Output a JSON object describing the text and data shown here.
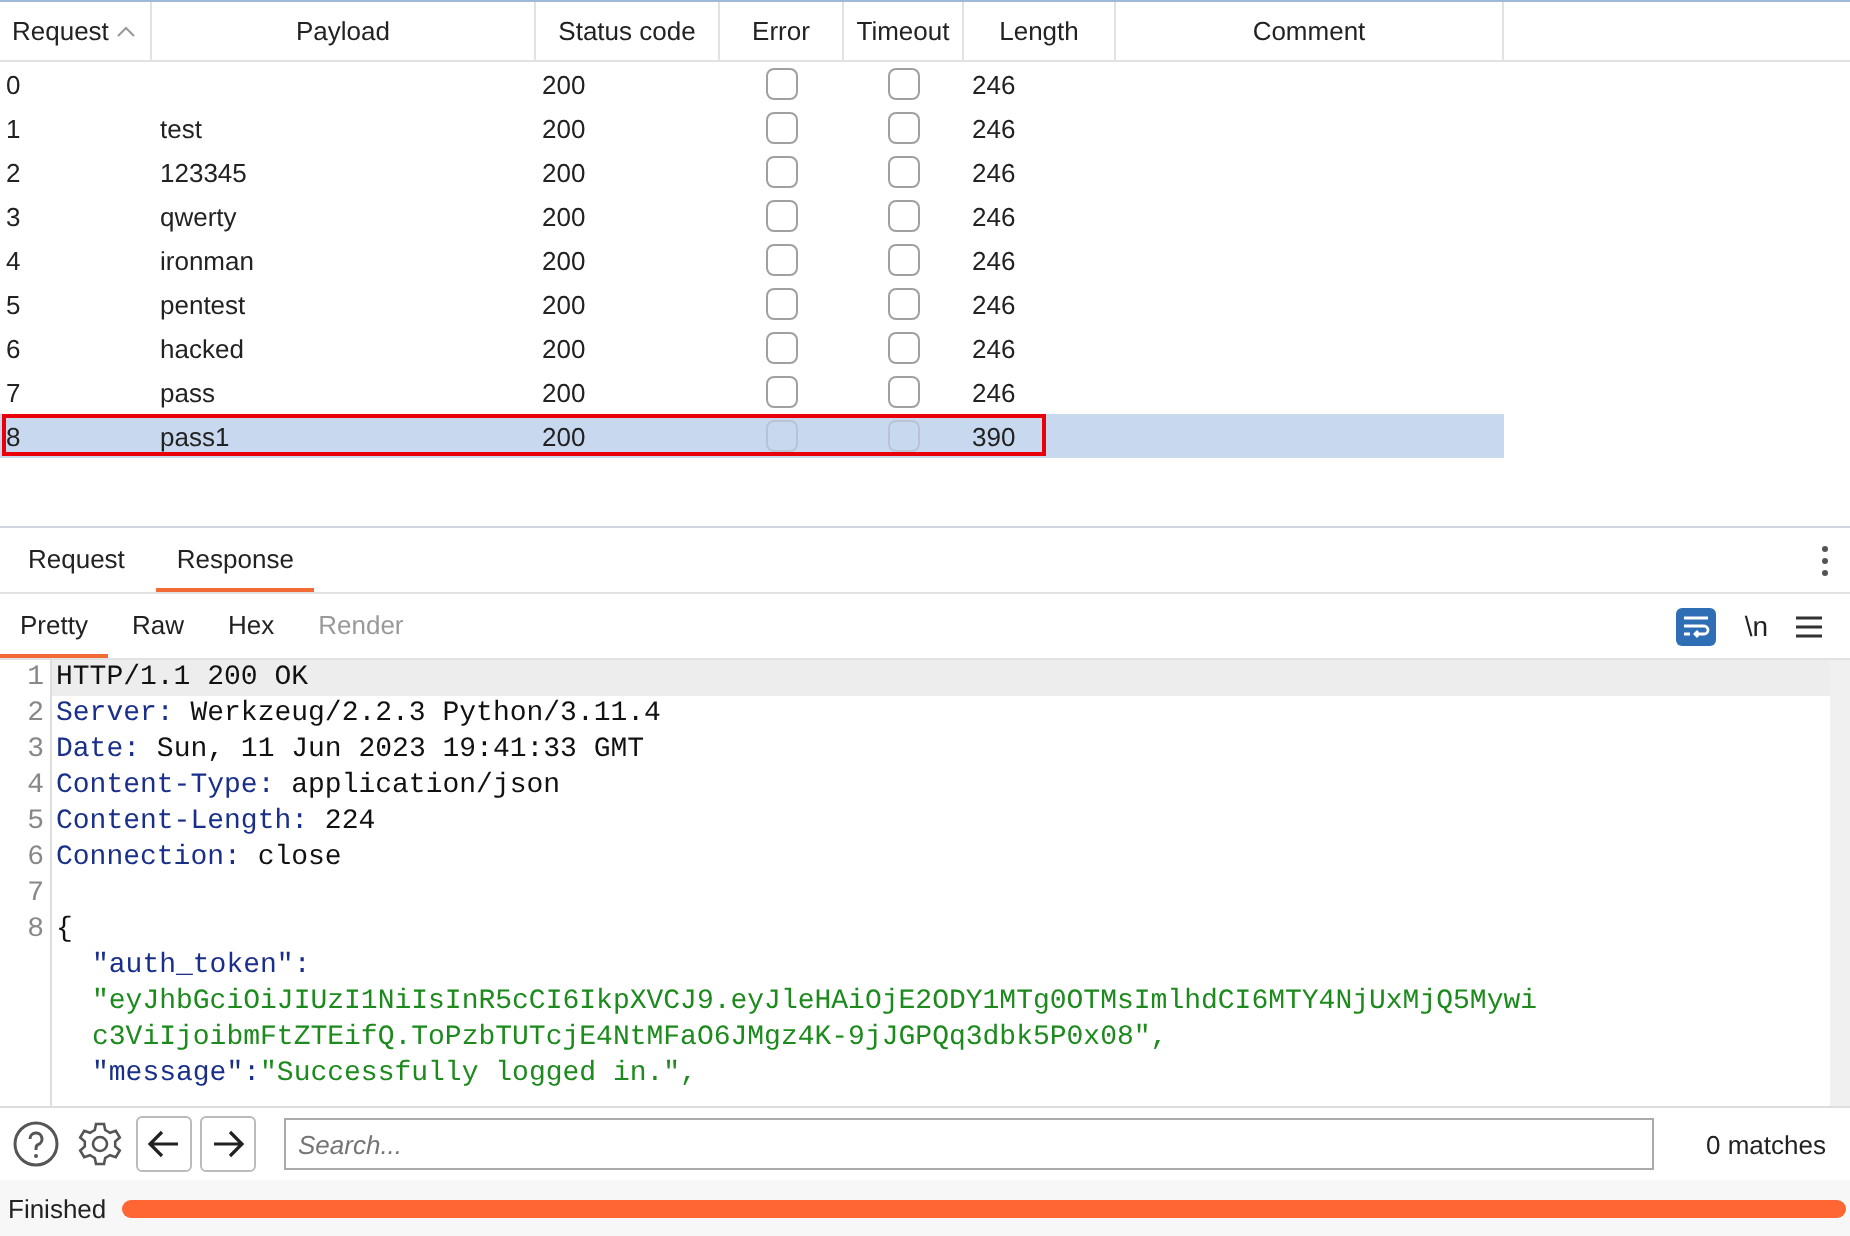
{
  "table": {
    "columns": [
      {
        "label": "Request",
        "sorted": true
      },
      {
        "label": "Payload",
        "sorted": false
      },
      {
        "label": "Status code",
        "sorted": false
      },
      {
        "label": "Error",
        "sorted": false
      },
      {
        "label": "Timeout",
        "sorted": false
      },
      {
        "label": "Length",
        "sorted": false
      },
      {
        "label": "Comment",
        "sorted": false
      }
    ],
    "rows": [
      {
        "request": "0",
        "payload": "",
        "status": "200",
        "error": false,
        "timeout": false,
        "length": "246",
        "selected": false,
        "outlined": false
      },
      {
        "request": "1",
        "payload": "test",
        "status": "200",
        "error": false,
        "timeout": false,
        "length": "246",
        "selected": false,
        "outlined": false
      },
      {
        "request": "2",
        "payload": "123345",
        "status": "200",
        "error": false,
        "timeout": false,
        "length": "246",
        "selected": false,
        "outlined": false
      },
      {
        "request": "3",
        "payload": "qwerty",
        "status": "200",
        "error": false,
        "timeout": false,
        "length": "246",
        "selected": false,
        "outlined": false
      },
      {
        "request": "4",
        "payload": "ironman",
        "status": "200",
        "error": false,
        "timeout": false,
        "length": "246",
        "selected": false,
        "outlined": false
      },
      {
        "request": "5",
        "payload": "pentest",
        "status": "200",
        "error": false,
        "timeout": false,
        "length": "246",
        "selected": false,
        "outlined": false
      },
      {
        "request": "6",
        "payload": "hacked",
        "status": "200",
        "error": false,
        "timeout": false,
        "length": "246",
        "selected": false,
        "outlined": false
      },
      {
        "request": "7",
        "payload": "pass",
        "status": "200",
        "error": false,
        "timeout": false,
        "length": "246",
        "selected": false,
        "outlined": false
      },
      {
        "request": "8",
        "payload": "pass1",
        "status": "200",
        "error": false,
        "timeout": false,
        "length": "390",
        "selected": true,
        "outlined": true
      }
    ]
  },
  "message_tabs": [
    {
      "label": "Request",
      "selected": false
    },
    {
      "label": "Response",
      "selected": true
    }
  ],
  "view_tabs": [
    {
      "label": "Pretty",
      "selected": true,
      "disabled": false
    },
    {
      "label": "Raw",
      "selected": false,
      "disabled": false
    },
    {
      "label": "Hex",
      "selected": false,
      "disabled": false
    },
    {
      "label": "Render",
      "selected": false,
      "disabled": true
    }
  ],
  "view_options": {
    "word_wrap": true,
    "newline_label": "\\n"
  },
  "code_lines": [
    {
      "number": "1",
      "kind": "status",
      "text": "HTTP/1.1 200 OK",
      "current": true
    },
    {
      "number": "2",
      "kind": "header",
      "key": "Server:",
      "text": " Werkzeug/2.2.3 Python/3.11.4",
      "current": false
    },
    {
      "number": "3",
      "kind": "header",
      "key": "Date:",
      "text": " Sun, 11 Jun 2023 19:41:33 GMT",
      "current": false
    },
    {
      "number": "4",
      "kind": "header",
      "key": "Content-Type:",
      "text": " application/json",
      "current": false
    },
    {
      "number": "5",
      "kind": "header",
      "key": "Content-Length:",
      "text": " 224",
      "current": false
    },
    {
      "number": "6",
      "kind": "header",
      "key": "Connection:",
      "text": " close",
      "current": false
    },
    {
      "number": "7",
      "kind": "blank",
      "current": false
    },
    {
      "number": "8",
      "kind": "plain",
      "text": "{",
      "current": false
    },
    {
      "kind": "json_key",
      "text": "\"auth_token\":",
      "current": false
    },
    {
      "kind": "json_string",
      "text": "\"eyJhbGciOiJIUzI1NiIsInR5cCI6IkpXVCJ9.eyJleHAiOjE2ODY1MTg0OTMsImlhdCI6MTY4NjUxMjQ5Mywi",
      "current": false
    },
    {
      "kind": "json_string",
      "text": "c3ViIjoibmFtZTEifQ.ToPzbTUTcjE4NtMFaO6JMgz4K-9jJGPQq3dbk5P0x08\",",
      "current": false
    },
    {
      "kind": "json_pair",
      "key": "\"message\":",
      "text": "\"Successfully logged in.\",",
      "current": false
    }
  ],
  "search": {
    "placeholder": "Search...",
    "matches": "0 matches"
  },
  "status_bar": {
    "text": "Finished",
    "level": 1
  }
}
